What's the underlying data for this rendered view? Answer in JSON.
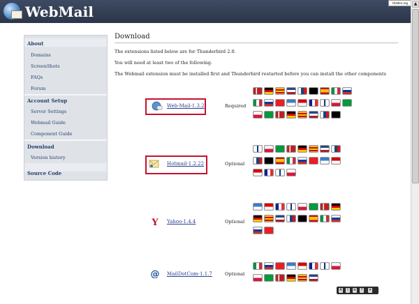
{
  "app": {
    "title": "WebMail",
    "badge": "Hidden.org"
  },
  "sidebar": {
    "sections": [
      {
        "label": "About",
        "items": [
          "Domains",
          "ScreenShots",
          "FAQs",
          "Forum"
        ]
      },
      {
        "label": "Account Setup",
        "items": [
          "Server Settings",
          "Webmail Guide",
          "Component Guide"
        ]
      },
      {
        "label": "Download",
        "items": [
          "Version history"
        ]
      },
      {
        "label": "Source Code",
        "items": []
      }
    ]
  },
  "main": {
    "title": "Download",
    "intro": [
      "The extensions listed below are for Thunderbird 2.0.",
      "You will need at least two of the following.",
      "The Webmail extension must be installed first and Thunderbird restarted before you can install the other components"
    ]
  },
  "extensions": [
    {
      "name": "Web-Mail-1.3.2",
      "status": "Required",
      "icon": "globe-envelope-icon",
      "highlighted": true,
      "flag_rows": 3
    },
    {
      "name": "Hotmail-1.2.22",
      "status": "Optional",
      "icon": "hotmail-envelope-icon",
      "highlighted": true,
      "flag_rows": 3
    },
    {
      "name": "Yahoo-1.4.4",
      "status": "Optional",
      "icon": "yahoo-y-icon",
      "highlighted": false,
      "flag_rows": 3
    },
    {
      "name": "MailDotCom-1.1.7",
      "status": "Optional",
      "icon": "at-sign-icon",
      "highlighted": false,
      "flag_rows": 2
    }
  ],
  "colors": {
    "header": "#2c3549",
    "sidebar_bg": "#dfe3e8",
    "link": "#2a3f8f",
    "highlight_border": "#c8102e"
  },
  "floating_toolbar": {
    "icons": [
      "A",
      "I",
      "≡",
      "?",
      "▾"
    ]
  }
}
